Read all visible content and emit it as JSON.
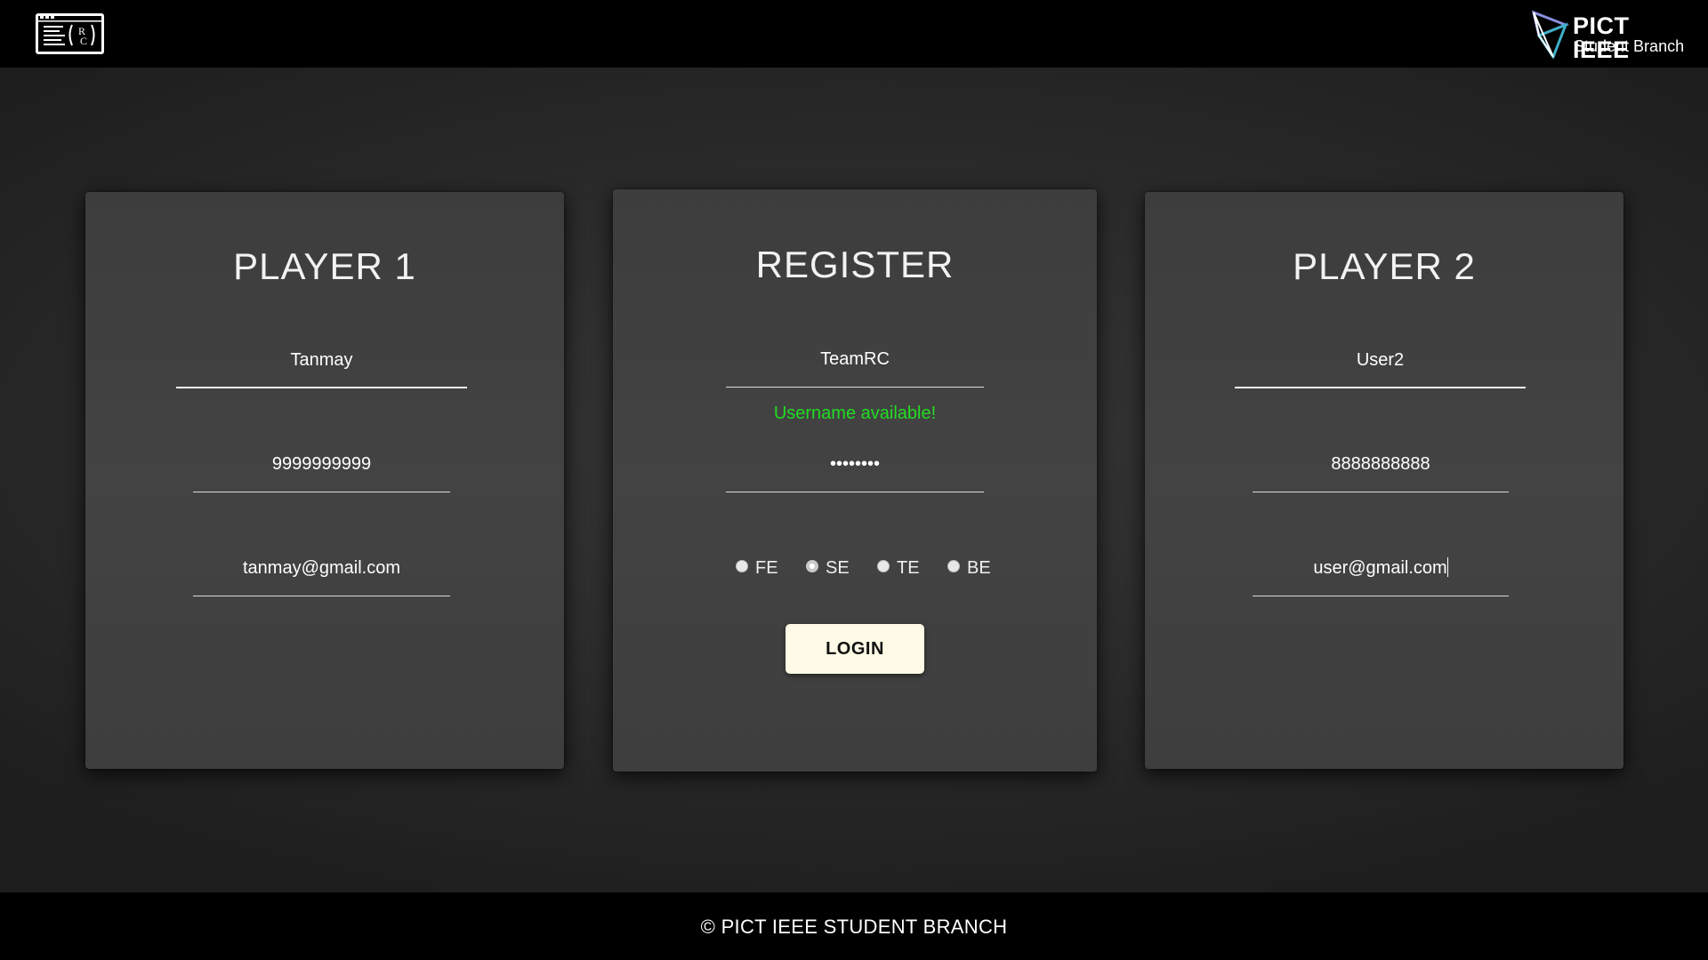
{
  "header": {
    "logo_left_icon": "rc-terminal-logo-icon",
    "brand_name": "PICT IEEE",
    "brand_sub": "Student Branch"
  },
  "player1": {
    "title": "PLAYER 1",
    "name": "Tanmay",
    "phone": "9999999999",
    "email": "tanmay@gmail.com"
  },
  "register": {
    "title": "REGISTER",
    "username": "TeamRC",
    "username_status": "Username available!",
    "status_color": "#22dd22",
    "password_masked": "••••••••",
    "year_options": [
      "FE",
      "SE",
      "TE",
      "BE"
    ],
    "year_selected": "SE",
    "login_label": "LOGIN"
  },
  "player2": {
    "title": "PLAYER 2",
    "name": "User2",
    "phone": "8888888888",
    "email": "user@gmail.com"
  },
  "footer": {
    "text": "© PICT IEEE STUDENT BRANCH"
  }
}
